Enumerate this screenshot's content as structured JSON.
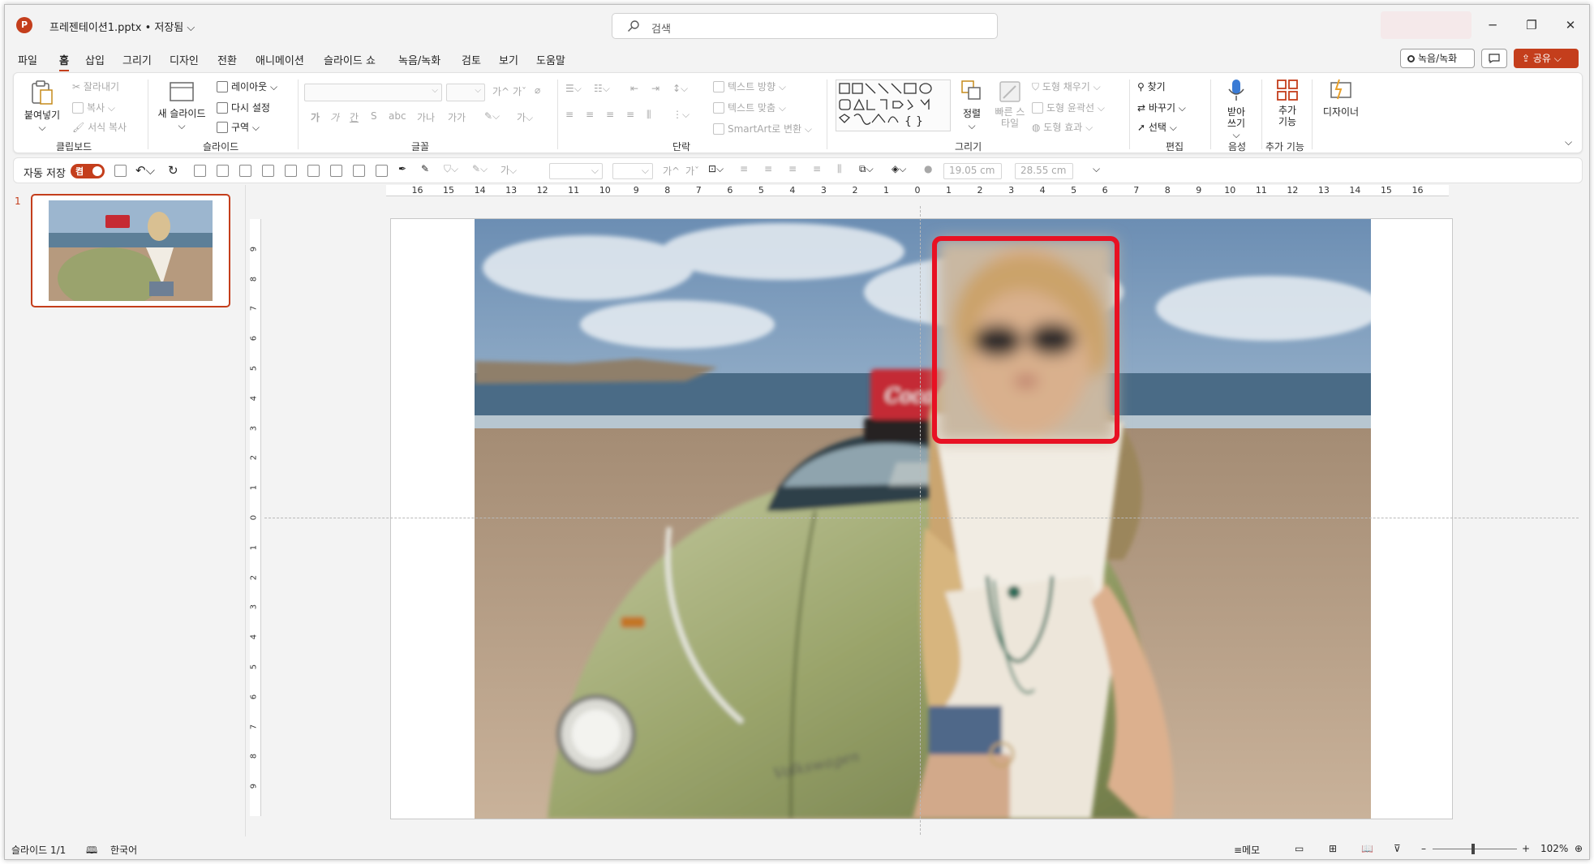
{
  "app": {
    "logo_letter": "P",
    "doc_title": "프레젠테이션1.pptx • 저장됨 ⌵"
  },
  "search": {
    "placeholder": "검색"
  },
  "window_buttons": {
    "minimize": "─",
    "restore": "❐",
    "close": "✕"
  },
  "menu_tabs": [
    "파일",
    "홈",
    "삽입",
    "그리기",
    "디자인",
    "전환",
    "애니메이션",
    "슬라이드 쇼",
    "녹음/녹화",
    "검토",
    "보기",
    "도움말"
  ],
  "active_tab": "홈",
  "top_right": {
    "record_label": "녹음/녹화",
    "comment_icon": "comment-icon",
    "share_label": "공유 ⌵"
  },
  "ribbon": {
    "clipboard": {
      "paste": "붙여넣기",
      "cut": "잘라내기",
      "copy": "복사",
      "format_painter": "서식 복사",
      "label": "클립보드"
    },
    "slides": {
      "new_slide": "새 슬라이드",
      "layout": "레이아웃 ⌵",
      "reset": "다시 설정",
      "section": "구역 ⌵",
      "label": "슬라이드"
    },
    "font": {
      "label": "글꼴",
      "grow": "가^",
      "shrink": "가ˇ",
      "bold": "가",
      "italic": "가",
      "underline": "간",
      "strike": "S",
      "spacing": "가나",
      "case": "가가"
    },
    "paragraph": {
      "label": "단락",
      "text_direction": "텍스트 방향 ⌵",
      "align_text": "텍스트 맞춤 ⌵",
      "smartart": "SmartArt로 변환 ⌵"
    },
    "drawing": {
      "label": "그리기",
      "arrange": "정렬",
      "quick_styles": "빠른 스타일",
      "fill": "도형 채우기 ⌵",
      "outline": "도형 윤곽선 ⌵",
      "effects": "도형 효과 ⌵"
    },
    "editing": {
      "label": "편집",
      "find": "찾기",
      "replace": "바꾸기 ⌵",
      "select": "선택 ⌵"
    },
    "voice": {
      "label": "음성",
      "dictate": "받아 쓰기 ⌵"
    },
    "addins": {
      "label": "추가 기능",
      "addins": "추가 기능"
    },
    "designer": {
      "label": "디자이너"
    }
  },
  "qat": {
    "autosave_label": "자동 저장",
    "autosave_state": "켬",
    "width_value": "19.05 cm",
    "height_value": "28.55 cm"
  },
  "thumbnail": {
    "number": "1"
  },
  "ruler": {
    "h_ticks": [
      "16",
      "15",
      "14",
      "13",
      "12",
      "11",
      "10",
      "9",
      "8",
      "7",
      "6",
      "5",
      "4",
      "3",
      "2",
      "1",
      "0",
      "1",
      "2",
      "3",
      "4",
      "5",
      "6",
      "7",
      "8",
      "9",
      "10",
      "11",
      "12",
      "13",
      "14",
      "15",
      "16"
    ],
    "v_ticks": [
      "9",
      "8",
      "7",
      "6",
      "5",
      "4",
      "3",
      "2",
      "1",
      "0",
      "1",
      "2",
      "3",
      "4",
      "5",
      "6",
      "7",
      "8",
      "9"
    ]
  },
  "photo": {
    "brand_text": "Coca-Cola"
  },
  "status": {
    "slide_info": "슬라이드 1/1",
    "language": "한국어",
    "notes": "≡메모",
    "zoom": "102%",
    "zoom_minus": "–",
    "zoom_plus": "+"
  },
  "colors": {
    "accent": "#c43e1c",
    "selection": "#e81123"
  }
}
